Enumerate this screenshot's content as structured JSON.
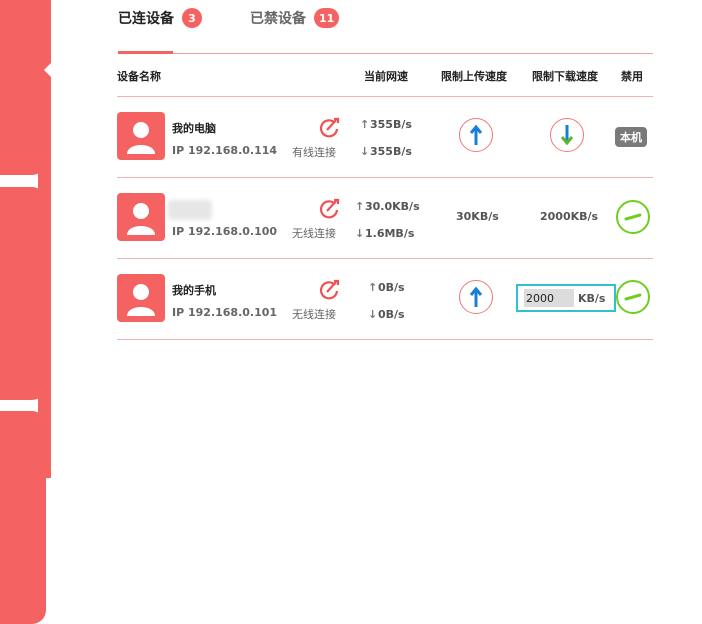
{
  "tabs": [
    {
      "label": "已连设备",
      "count": "3"
    },
    {
      "label": "已禁设备",
      "count": "11"
    }
  ],
  "columns": {
    "device_name": "设备名称",
    "current_speed": "当前网速",
    "limit_upload": "限制上传速度",
    "limit_download": "限制下载速度",
    "disable": "禁用"
  },
  "devices": [
    {
      "name": "我的电脑",
      "ip": "IP 192.168.0.114",
      "connection": "有线连接",
      "up": "355B/s",
      "down": "355B/s",
      "upload_limit": "",
      "download_limit": "",
      "tag": "本机"
    },
    {
      "name": "",
      "ip": "IP 192.168.0.100",
      "connection": "无线连接",
      "up": "30.0KB/s",
      "down": "1.6MB/s",
      "upload_limit": "30KB/s",
      "download_limit": "2000KB/s",
      "tag": ""
    },
    {
      "name": "我的手机",
      "ip": "IP 192.168.0.101",
      "connection": "无线连接",
      "up": "0B/s",
      "down": "0B/s",
      "upload_limit": "",
      "download_limit_value": "2000",
      "download_limit_unit": "KB/s",
      "tag": ""
    }
  ],
  "icons": {
    "up_arrow": "up-arrow-icon",
    "down_arrow": "down-arrow-icon",
    "edit": "edit-icon",
    "avatar": "user-avatar-icon",
    "disable": "disable-icon"
  },
  "colors": {
    "accent": "#f56262",
    "edit": "#f05050",
    "arrow_blue": "#1a7ed8",
    "arrow_green": "#5cb82a",
    "disable_green": "#6fce21",
    "focus": "#2cc3cc"
  }
}
